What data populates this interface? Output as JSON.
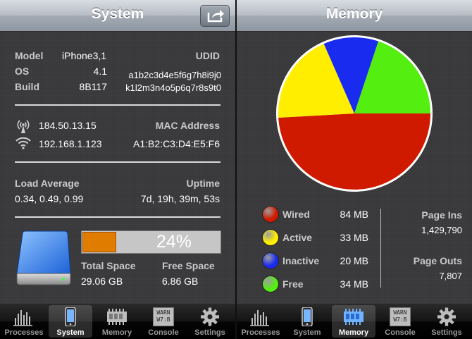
{
  "system": {
    "title": "System",
    "model_label": "Model",
    "model_value": "iPhone3,1",
    "os_label": "OS",
    "os_value": "4.1",
    "build_label": "Build",
    "build_value": "8B117",
    "udid_label": "UDID",
    "udid_line1": "a1b2c3d4e5f6g7h8i9j0",
    "udid_line2": "k1l2m3n4o5p6q7r8s9t0",
    "cell_ip": "184.50.13.15",
    "wifi_ip": "192.168.1.123",
    "mac_label": "MAC Address",
    "mac_value": "A1:B2:C3:D4:E5:F6",
    "load_label": "Load Average",
    "load_value": "0.34, 0.49, 0.99",
    "uptime_label": "Uptime",
    "uptime_value": "7d, 19h, 39m, 53s",
    "disk_usage_percent_text": "24%",
    "disk_usage_fraction": 0.24,
    "total_label": "Total Space",
    "total_value": "29.06 GB",
    "free_label": "Free Space",
    "free_value": "6.86 GB"
  },
  "memory": {
    "title": "Memory",
    "legend": [
      {
        "label": "Wired",
        "value": "84 MB",
        "color": "#d01a00"
      },
      {
        "label": "Active",
        "value": "33 MB",
        "color": "#ffee00"
      },
      {
        "label": "Inactive",
        "value": "20 MB",
        "color": "#1a2bf0"
      },
      {
        "label": "Free",
        "value": "34 MB",
        "color": "#55ee11"
      }
    ],
    "page_ins_label": "Page Ins",
    "page_ins_value": "1,429,790",
    "page_outs_label": "Page Outs",
    "page_outs_value": "7,807"
  },
  "tabs": [
    {
      "label": "Processes",
      "icon": "bars-chart-icon"
    },
    {
      "label": "System",
      "icon": "phone-icon"
    },
    {
      "label": "Memory",
      "icon": "memory-chip-icon"
    },
    {
      "label": "Console",
      "icon": "console-log-icon"
    },
    {
      "label": "Settings",
      "icon": "gear-icon"
    }
  ],
  "left_selected_tab": "System",
  "right_selected_tab": "Memory",
  "console_icon_text": [
    "WARN",
    "W7:B"
  ],
  "chart_data": {
    "type": "pie",
    "categories": [
      "Wired",
      "Active",
      "Inactive",
      "Free"
    ],
    "values": [
      84,
      33,
      20,
      34
    ]
  }
}
